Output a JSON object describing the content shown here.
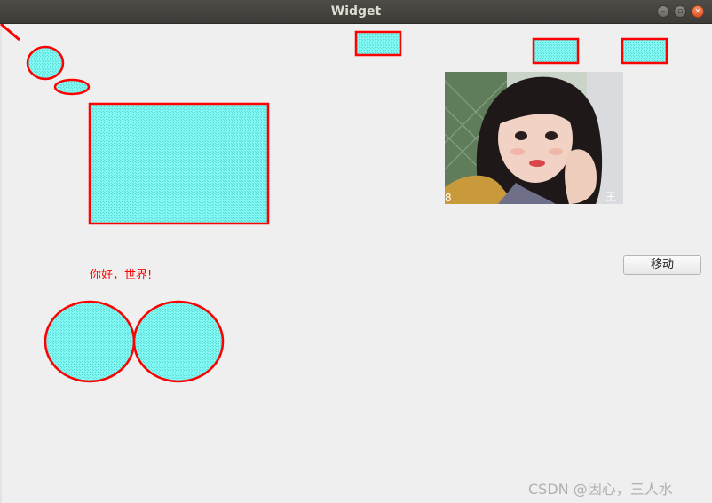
{
  "window": {
    "title": "Widget",
    "controls": [
      "minimize-icon",
      "maximize-icon",
      "close-icon"
    ]
  },
  "shapes": {
    "fill_color": "#7ff7f3",
    "stroke_color": "#ff0000",
    "items": [
      "line",
      "small-circle",
      "small-ellipse",
      "rectangle-large",
      "rectangle-top-center",
      "rectangle-top-right-1",
      "rectangle-top-right-2",
      "circle-bottom-left",
      "circle-bottom-right"
    ]
  },
  "image": {
    "description_icon": "photo-portrait",
    "overlay_right": "王",
    "overlay_left": "8"
  },
  "button": {
    "move_label": "移动"
  },
  "text": {
    "hello": "你好，世界!"
  },
  "watermark": {
    "text": "CSDN @因心，三人水"
  }
}
